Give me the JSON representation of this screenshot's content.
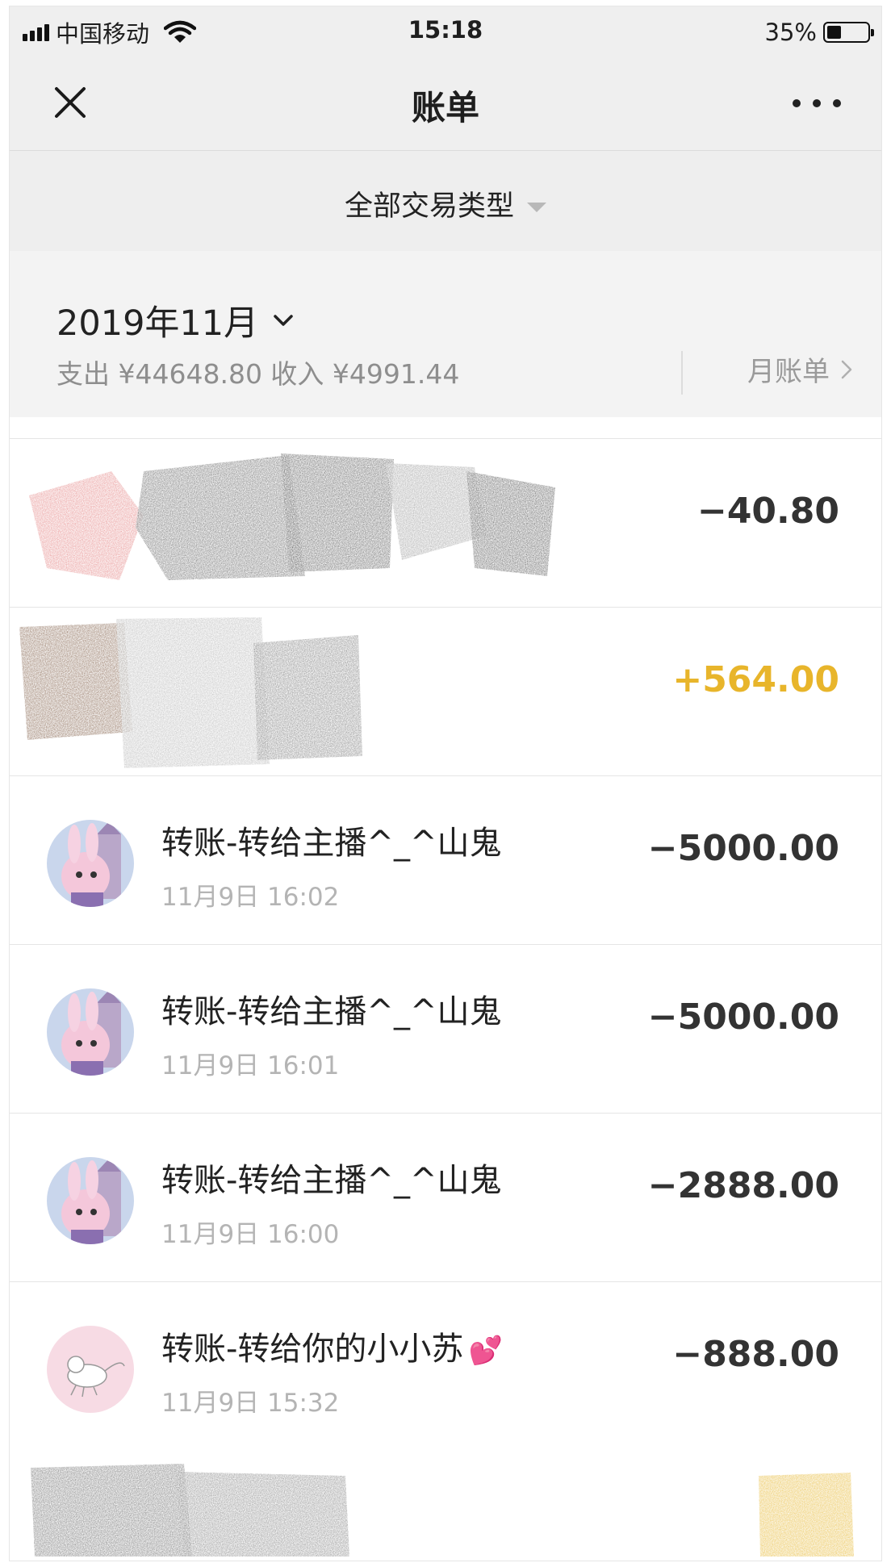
{
  "status_bar": {
    "carrier": "中国移动",
    "time": "15:18",
    "battery": "35%",
    "battery_level": 0.35,
    "icons": [
      "signal-icon",
      "wifi-icon",
      "battery-icon"
    ]
  },
  "nav": {
    "title": "账单",
    "close_icon": "close-icon",
    "more_icon": "more-icon"
  },
  "filter": {
    "label": "全部交易类型",
    "icon": "triangle-down-icon"
  },
  "month": {
    "title": "2019年11月",
    "summary": "支出 ¥44648.80 收入 ¥4991.44",
    "bill_label": "月账单"
  },
  "transactions": [
    {
      "title": "",
      "time": "",
      "amount": "−40.80",
      "type": "expense",
      "redacted": true
    },
    {
      "title": "",
      "time": "",
      "amount": "+564.00",
      "type": "income",
      "redacted": true
    },
    {
      "title": "转账-转给主播^_^山鬼",
      "time": "11月9日 16:02",
      "amount": "−5000.00",
      "type": "expense"
    },
    {
      "title": "转账-转给主播^_^山鬼",
      "time": "11月9日 16:01",
      "amount": "−5000.00",
      "type": "expense"
    },
    {
      "title": "转账-转给主播^_^山鬼",
      "time": "11月9日 16:00",
      "amount": "−2888.00",
      "type": "expense"
    },
    {
      "title": "转账-转给你的小小苏",
      "time": "11月9日 15:32",
      "amount": "−888.00",
      "type": "expense",
      "emoji": "💕"
    }
  ],
  "colors": {
    "income": "#e8b52b",
    "expense": "#333333",
    "header_bg": "#efefef"
  }
}
